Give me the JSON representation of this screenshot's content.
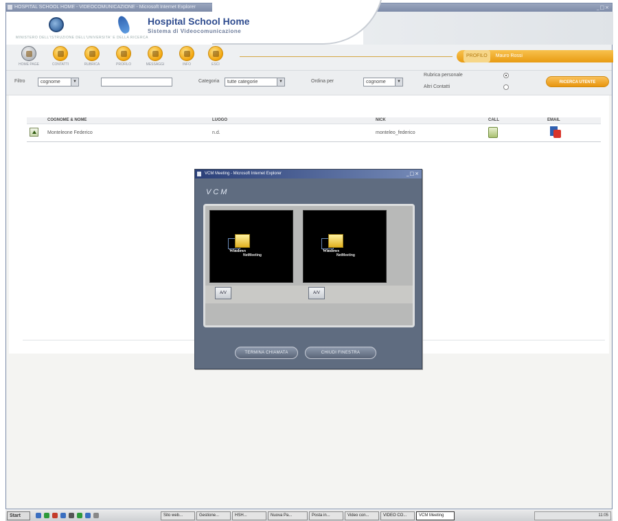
{
  "window": {
    "title": "HOSPITAL SCHOOL HOME - VIDEOCOMUNICAZIONE - Microsoft Internet Explorer",
    "controls": "_□×"
  },
  "header": {
    "logo_caption": "MINISTERO DELL'ISTRUZIONE DELL'UNIVERSITA' E DELLA RICERCA",
    "app_title": "Hospital School Home",
    "app_subtitle": "Sistema di Videocomunicazione"
  },
  "toolbar": {
    "buttons": [
      {
        "label": "HOME PAGE"
      },
      {
        "label": "CONTATTI"
      },
      {
        "label": "RUBRICA"
      },
      {
        "label": "PROFILO"
      },
      {
        "label": "MESSAGGI"
      },
      {
        "label": "INFO"
      },
      {
        "label": "ESCI"
      }
    ],
    "user_profile": "PROFILO",
    "user_name": "Mauro Rossi"
  },
  "filters": {
    "filter_label": "Filtro",
    "filter_value": "cognome",
    "search_value": "",
    "category_label": "Categoria",
    "category_value": "tutte categorie",
    "order_label": "Ordina per",
    "order_value": "cognome",
    "personal_label": "Rubrica personale",
    "other_label": "Altri Contatti",
    "personal_selected": true,
    "search_button": "RICERCA UTENTE"
  },
  "table": {
    "columns": [
      "COGNOME & NOME",
      "LUOGO",
      "NICK",
      "CALL",
      "EMAIL"
    ],
    "rows": [
      {
        "name": "Monteleone Federico",
        "place": "n.d.",
        "nick": "monteleo_federico"
      }
    ]
  },
  "popup": {
    "title": "VCM Meeting - Microsoft Internet Explorer",
    "controls": "_□×",
    "brand": "VCM",
    "video_logo_line1": "Windows",
    "video_logo_line2": "NetMeeting",
    "video_button": "A/V",
    "buttons": [
      "TERMINA CHIAMATA",
      "CHIUDI FINESTRA"
    ]
  },
  "taskbar": {
    "start": "Start",
    "tasks": [
      "Sito web...",
      "Gestione...",
      "HSH...",
      "Nuova Pa...",
      "Posta in...",
      "Video con...",
      "VIDEO CO...",
      "VCM Meeting"
    ],
    "active_task": 7,
    "clock": "11:05"
  }
}
